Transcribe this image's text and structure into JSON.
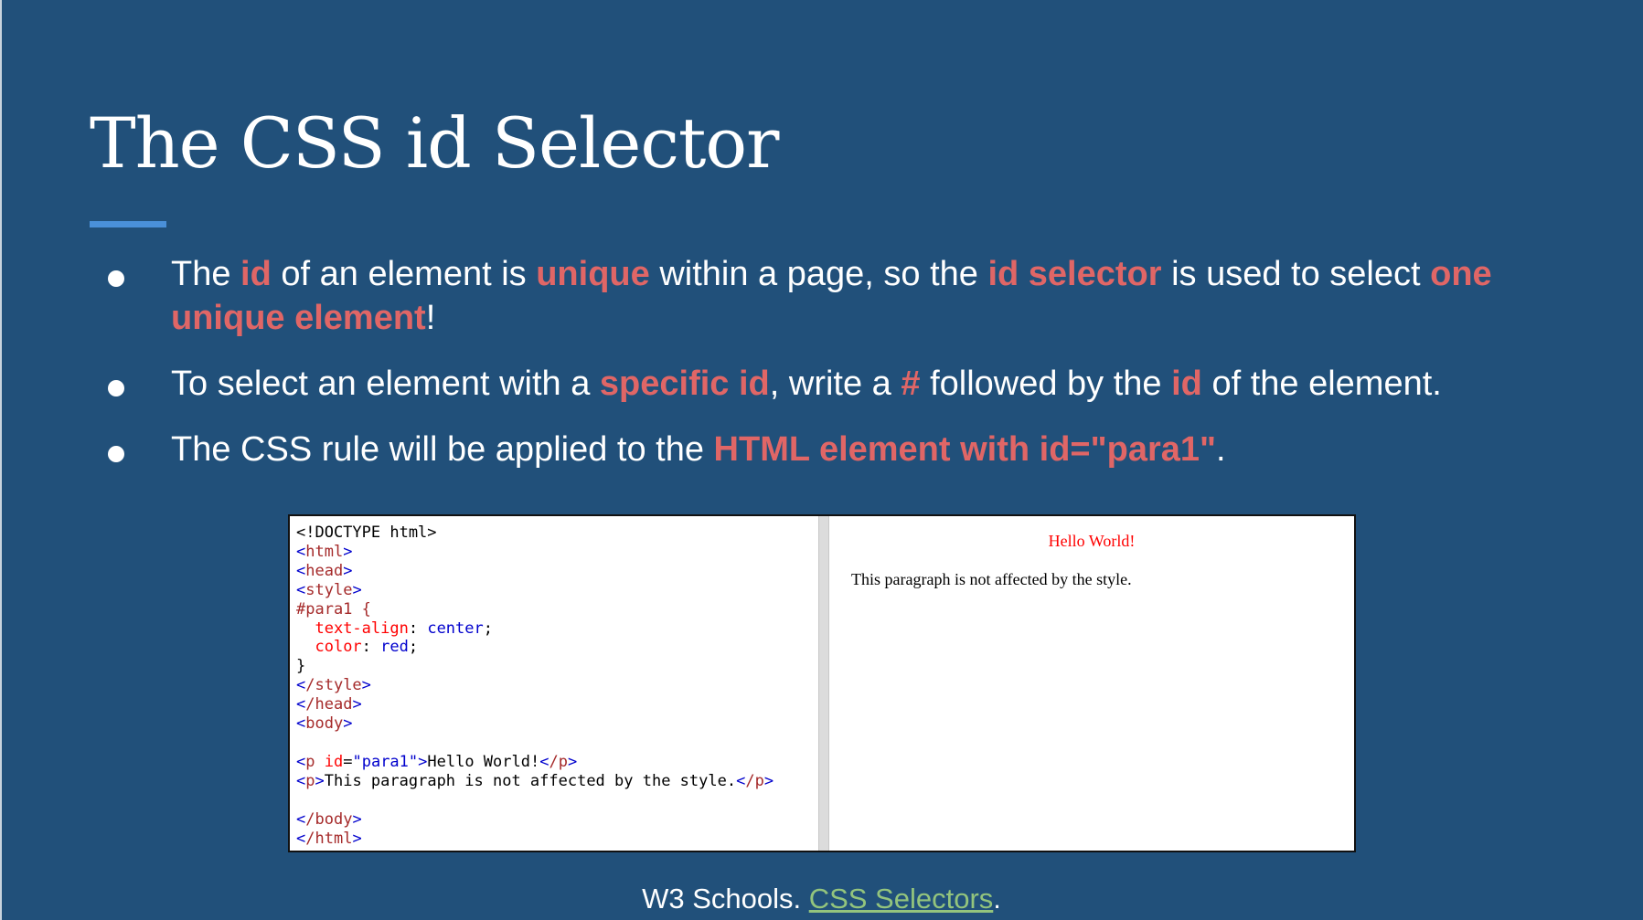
{
  "slide": {
    "title": "The CSS id Selector",
    "bullets": [
      {
        "t1": "The ",
        "h1": "id",
        "t2": " of an element is ",
        "h2": "unique",
        "t3": " within a page, so the ",
        "h3": "id selector",
        "t4": " is used to select ",
        "h4": "one unique element",
        "t5": "!"
      },
      {
        "t1": "To select an element with a ",
        "h1": "specific id",
        "t2": ", write a ",
        "h2": "#",
        "t3": " followed by the ",
        "h3": "id",
        "t4": " of the element."
      },
      {
        "t1": "The CSS rule will be applied to the ",
        "h1": "HTML element with id=\"para1\"",
        "t2": "."
      }
    ],
    "code": {
      "doctype": "<!DOCTYPE html>",
      "html_open": "html",
      "head_open": "head",
      "style_open": "style",
      "selector": "#para1 {",
      "prop1": "text-align",
      "val1": "center",
      "prop2": "color",
      "val2": "red",
      "close_brace": "}",
      "style_close": "/style",
      "head_close": "/head",
      "body_open": "body",
      "p_tag": "p",
      "p_attr": "id",
      "p_attr_val": "\"para1\"",
      "p1_text": "Hello World!",
      "p_close": "/p",
      "p2_text": "This paragraph is not affected by the style.",
      "body_close": "/body",
      "html_close": "/html"
    },
    "preview": {
      "p1": "Hello World!",
      "p2": "This paragraph is not affected by the style."
    },
    "source": {
      "prefix": "W3 Schools. ",
      "link": "CSS Selectors",
      "suffix": "."
    }
  },
  "colors": {
    "background": "#21507a",
    "highlight": "#e06666",
    "accent_rule": "#4a90d9",
    "link": "#93c47d"
  }
}
